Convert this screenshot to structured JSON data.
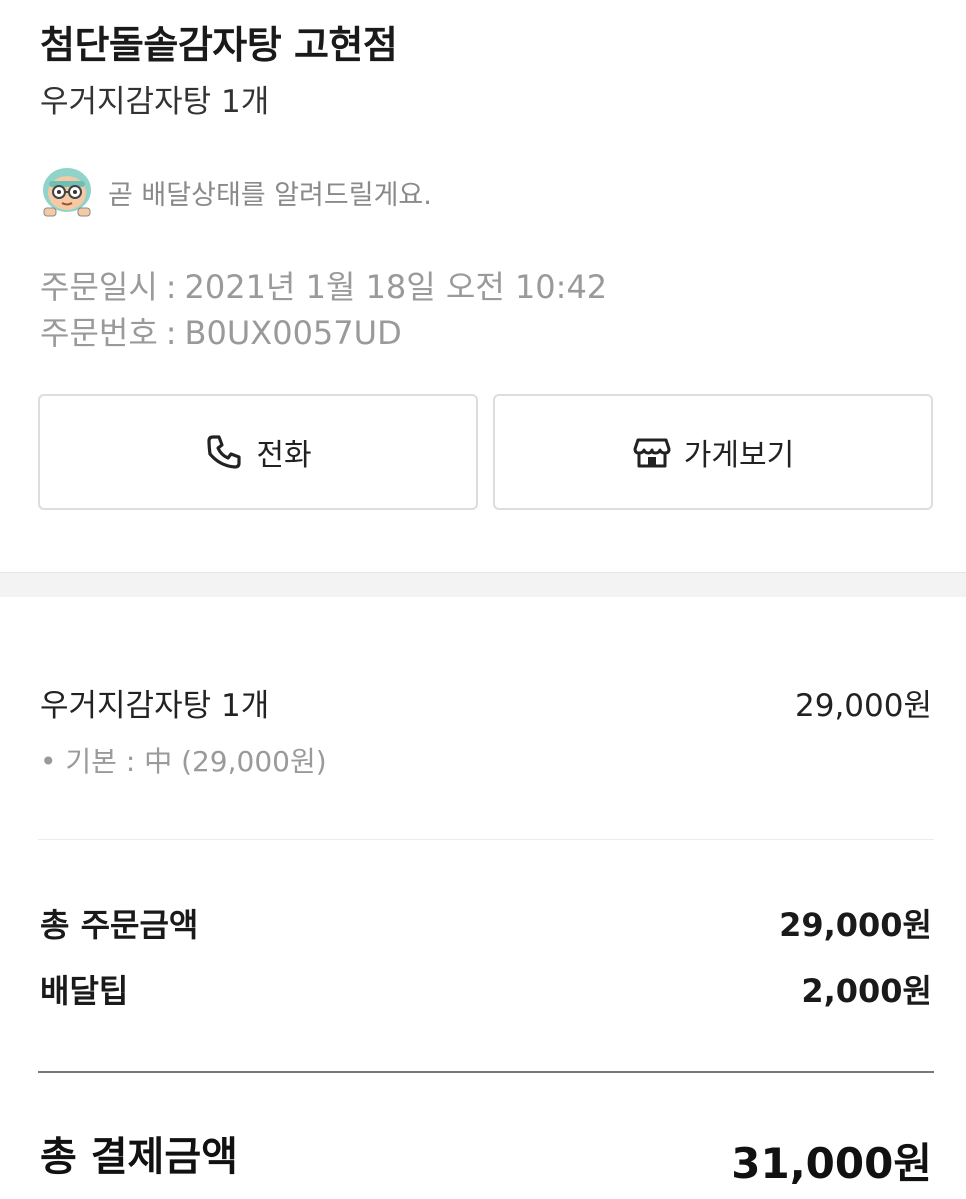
{
  "store": {
    "name": "첨단돌솥감자탕 고현점",
    "order_summary": "우거지감자탕 1개"
  },
  "notice": {
    "icon": "delivery-mascot-icon",
    "text": "곧 배달상태를 알려드릴게요."
  },
  "order_info": {
    "date_label": "주문일시",
    "date_value": "2021년 1월 18일 오전 10:42",
    "number_label": "주문번호",
    "number_value": "B0UX0057UD",
    "separator": ":"
  },
  "actions": {
    "call": {
      "label": "전화",
      "icon": "phone-icon"
    },
    "store": {
      "label": "가게보기",
      "icon": "store-icon"
    }
  },
  "items": [
    {
      "name": "우거지감자탕 1개",
      "price": "29,000원",
      "option": "• 기본 : 中 (29,000원)"
    }
  ],
  "summary": {
    "order_total_label": "총 주문금액",
    "order_total_value": "29,000원",
    "delivery_tip_label": "배달팁",
    "delivery_tip_value": "2,000원"
  },
  "payment": {
    "label": "총 결제금액",
    "value": "31,000원"
  },
  "colors": {
    "text_primary": "#1a1a1a",
    "text_muted": "#9a9a9a",
    "border": "#dddddd",
    "divider_band": "#f3f3f3",
    "mascot_helmet": "#8fd3c9"
  }
}
